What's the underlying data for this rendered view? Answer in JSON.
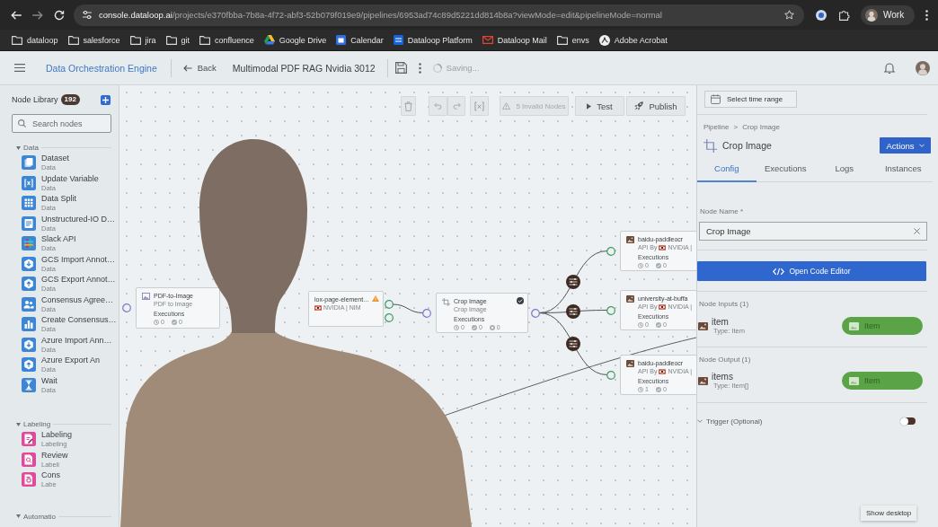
{
  "browser": {
    "url": {
      "host": "console.dataloop.ai",
      "path": "/projects/e370fbba-7b8a-4f72-abf3-52b079f019e9/pipelines/6953ad74c89d5221dd814b8a?viewMode=edit&pipelineMode=normal"
    },
    "profile": "Work",
    "bookmarks": [
      {
        "label": "dataloop",
        "kind": "folder"
      },
      {
        "label": "salesforce",
        "kind": "folder"
      },
      {
        "label": "jira",
        "kind": "folder"
      },
      {
        "label": "git",
        "kind": "folder"
      },
      {
        "label": "confluence",
        "kind": "folder"
      },
      {
        "label": "Google Drive",
        "kind": "drive"
      },
      {
        "label": "Calendar",
        "kind": "calendar"
      },
      {
        "label": "Dataloop Platform",
        "kind": "site"
      },
      {
        "label": "Dataloop Mail",
        "kind": "mail"
      },
      {
        "label": "envs",
        "kind": "folder"
      },
      {
        "label": "Adobe Acrobat",
        "kind": "acrobat"
      }
    ]
  },
  "header": {
    "app_name": "Data Orchestration Engine",
    "back": "Back",
    "pipeline_name": "Multimodal PDF RAG Nvidia 3012",
    "status": "Saving..."
  },
  "library": {
    "title": "Node Library",
    "count": "192",
    "search": {
      "placeholder": "Search nodes"
    },
    "sections": [
      {
        "title": "Data",
        "expanded": true,
        "items": [
          {
            "name": "Dataset",
            "category": "Data",
            "kind": "dataset"
          },
          {
            "name": "Update Variable",
            "category": "Data",
            "kind": "variable"
          },
          {
            "name": "Data Split",
            "category": "Data",
            "kind": "split"
          },
          {
            "name": "Unstructured-IO D…",
            "category": "Data",
            "kind": "text"
          },
          {
            "name": "Slack API",
            "category": "Data",
            "kind": "slack"
          },
          {
            "name": "GCS Import Annot…",
            "category": "Data",
            "kind": "import"
          },
          {
            "name": "GCS Export Annot…",
            "category": "Data",
            "kind": "export"
          },
          {
            "name": "Consensus Agree…",
            "category": "Data",
            "kind": "people"
          },
          {
            "name": "Create Consensus…",
            "category": "Data",
            "kind": "chart"
          },
          {
            "name": "Azure Import Ann…",
            "category": "Data",
            "kind": "import"
          },
          {
            "name": "Azure Export An",
            "category": "Data",
            "kind": "export"
          },
          {
            "name": "Wait",
            "category": "Data",
            "kind": "wait"
          }
        ]
      },
      {
        "title": "Labeling",
        "expanded": true,
        "items": [
          {
            "name": "Labeling",
            "category": "Labeling",
            "kind": "labeling"
          },
          {
            "name": "Review",
            "category": "Labeli",
            "kind": "review"
          },
          {
            "name": "Cons",
            "category": "Labe",
            "kind": "consensus"
          }
        ]
      },
      {
        "title": "Automatio",
        "expanded": true
      }
    ]
  },
  "canvas": {
    "toolbar": {
      "invalid_nodes": "5 Invalid Nodes",
      "test": "Test",
      "publish": "Publish"
    },
    "nodes": [
      {
        "kind": "converter",
        "title": "PDF-to-Image",
        "subtitle": "PDF to Image",
        "warning": false,
        "checked": false,
        "executions": "Executions",
        "stats": [
          {
            "kind": "pending",
            "count": "0"
          },
          {
            "kind": "success",
            "count": "0"
          }
        ]
      },
      {
        "kind": "nim",
        "title": "lox-page-element…",
        "subtitle": "NVIDIA | NIM",
        "warning": true,
        "checked": false
      },
      {
        "kind": "crop",
        "title": "Crop Image",
        "subtitle": "Crop Image",
        "warning": false,
        "checked": true,
        "executions": "Executions",
        "stats": [
          {
            "kind": "pending",
            "count": "0"
          },
          {
            "kind": "success",
            "count": "0"
          },
          {
            "kind": "failed",
            "count": "0"
          }
        ]
      },
      {
        "kind": "api",
        "title": "baidu-paddleocr",
        "subtitle_prefix": "API By",
        "subtitle": "NVIDIA |",
        "warning": false,
        "checked": false,
        "executions": "Executions",
        "stats": [
          {
            "kind": "pending",
            "count": "0"
          },
          {
            "kind": "success",
            "count": "0"
          }
        ]
      },
      {
        "kind": "api",
        "title": "university-at-buffa",
        "subtitle_prefix": "API By",
        "subtitle": "NVIDIA |",
        "warning": false,
        "checked": false,
        "executions": "Executions",
        "stats": [
          {
            "kind": "pending",
            "count": "0"
          },
          {
            "kind": "success",
            "count": "0"
          }
        ]
      },
      {
        "kind": "api",
        "title": "baidu-paddleocr",
        "subtitle_prefix": "API By",
        "subtitle": "NVIDIA |",
        "warning": false,
        "checked": false,
        "executions": "Executions",
        "stats": [
          {
            "kind": "pending",
            "count": "1"
          },
          {
            "kind": "success",
            "count": "0"
          }
        ]
      }
    ]
  },
  "panel": {
    "time_range": "Select time range",
    "breadcrumb": {
      "items": [
        "Pipeline",
        "Crop Image"
      ],
      "separator": ">"
    },
    "title": "Crop Image",
    "actions": "Actions",
    "tabs": [
      {
        "label": "Config",
        "selected": true
      },
      {
        "label": "Executions",
        "selected": false
      },
      {
        "label": "Logs",
        "selected": false
      },
      {
        "label": "Instances",
        "selected": false
      }
    ],
    "node_name": {
      "label": "Node Name *",
      "value": "Crop Image"
    },
    "code_editor": "Open Code Editor",
    "inputs": {
      "title": "Node Inputs (1)",
      "ports": [
        {
          "name": "item",
          "type": "Type: Item",
          "data_type": "Item"
        }
      ]
    },
    "outputs": {
      "title": "Node Output (1)",
      "ports": [
        {
          "name": "items",
          "type": "Type: Item[]",
          "data_type": "Item"
        }
      ]
    },
    "trigger": {
      "label": "Trigger (Optional)",
      "on": false
    }
  },
  "tooltip": "Show desktop"
}
